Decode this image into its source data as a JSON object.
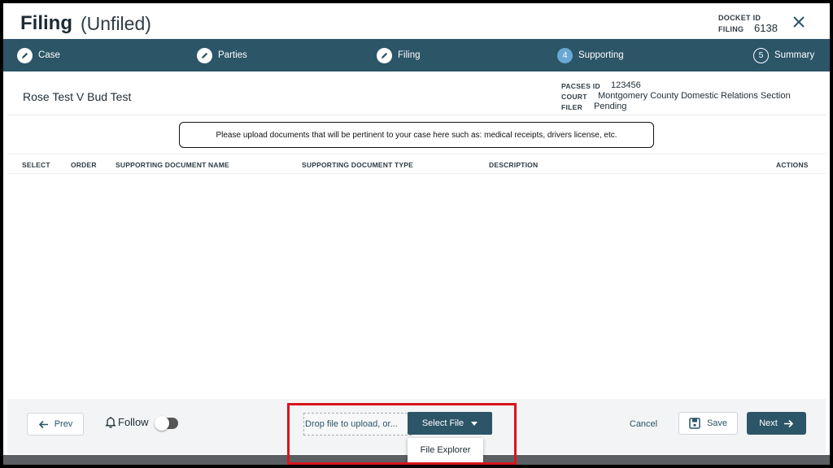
{
  "header": {
    "title": "Filing",
    "subtitle": "(Unfiled)",
    "docket_label": "DOCKET ID",
    "filing_label": "FILING",
    "filing_value": "6138"
  },
  "steps": [
    {
      "label": "Case",
      "state": "done",
      "icon": "pencil-icon"
    },
    {
      "label": "Parties",
      "state": "done",
      "icon": "pencil-icon"
    },
    {
      "label": "Filing",
      "state": "done",
      "icon": "pencil-icon"
    },
    {
      "label": "Supporting",
      "state": "active",
      "number": "4"
    },
    {
      "label": "Summary",
      "state": "todo",
      "number": "5"
    }
  ],
  "case": {
    "title": "Rose Test V Bud Test",
    "pacses_label": "PACSES ID",
    "pacses_value": "123456",
    "court_label": "COURT",
    "court_value": "Montgomery County Domestic Relations Section",
    "filer_label": "FILER",
    "filer_value": "Pending"
  },
  "notice": "Please upload documents that will be pertinent to your case here such as: medical receipts, drivers license, etc.",
  "table": {
    "columns": [
      "SELECT",
      "ORDER",
      "SUPPORTING DOCUMENT NAME",
      "SUPPORTING DOCUMENT TYPE",
      "DESCRIPTION",
      "ACTIONS"
    ]
  },
  "footer": {
    "prev_label": "Prev",
    "follow_label": "Follow",
    "follow_on": false,
    "dropzone_text": "Drop file to upload, or...",
    "select_file_label": "Select File",
    "menu_items": [
      "File Explorer"
    ],
    "cancel_label": "Cancel",
    "save_label": "Save",
    "next_label": "Next"
  },
  "colors": {
    "primary": "#2c5568",
    "active_step": "#6aa8d4",
    "highlight": "#d9141b"
  }
}
